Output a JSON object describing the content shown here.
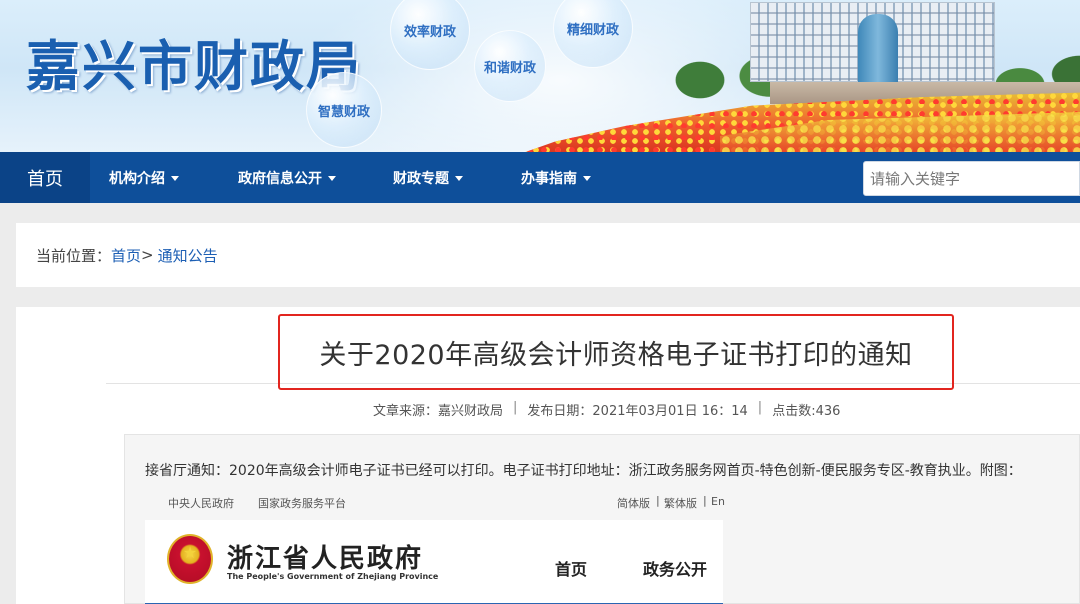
{
  "banner": {
    "site_title": "嘉兴市财政局",
    "bubbles": [
      "效率财政",
      "和谐财政",
      "精细财政",
      "智慧财政"
    ]
  },
  "nav": {
    "home": "首页",
    "items": [
      "机构介绍",
      "政府信息公开",
      "财政专题",
      "办事指南"
    ],
    "search_placeholder": "请输入关键字"
  },
  "breadcrumb": {
    "prefix": "当前位置：",
    "home": "首页",
    "separator": ">",
    "current": "通知公告"
  },
  "article": {
    "title": "关于2020年高级会计师资格电子证书打印的通知",
    "meta": {
      "source": "文章来源：嘉兴财政局",
      "date": "发布日期：2021年03月01日 16：14",
      "hits": "点击数:436",
      "divider": "|"
    },
    "body": "接省厅通知：2020年高级会计师电子证书已经可以打印。电子证书打印地址：浙江政务服务网首页-特色创新-便民服务专区-教育执业。附图："
  },
  "embedded_screenshot": {
    "top_links": [
      "中央人民政府",
      "国家政务服务平台"
    ],
    "lang_links": [
      "简体版",
      "繁体版",
      "En"
    ],
    "lang_sep": "|",
    "gov_name": "浙江省人民政府",
    "gov_name_en": "The People's Government of Zhejiang Province",
    "nav": [
      "首页",
      "政务公开"
    ]
  },
  "colors": {
    "nav_bg": "#0e4f9a",
    "link": "#1d5fb4",
    "highlight_border": "#e2251f"
  }
}
